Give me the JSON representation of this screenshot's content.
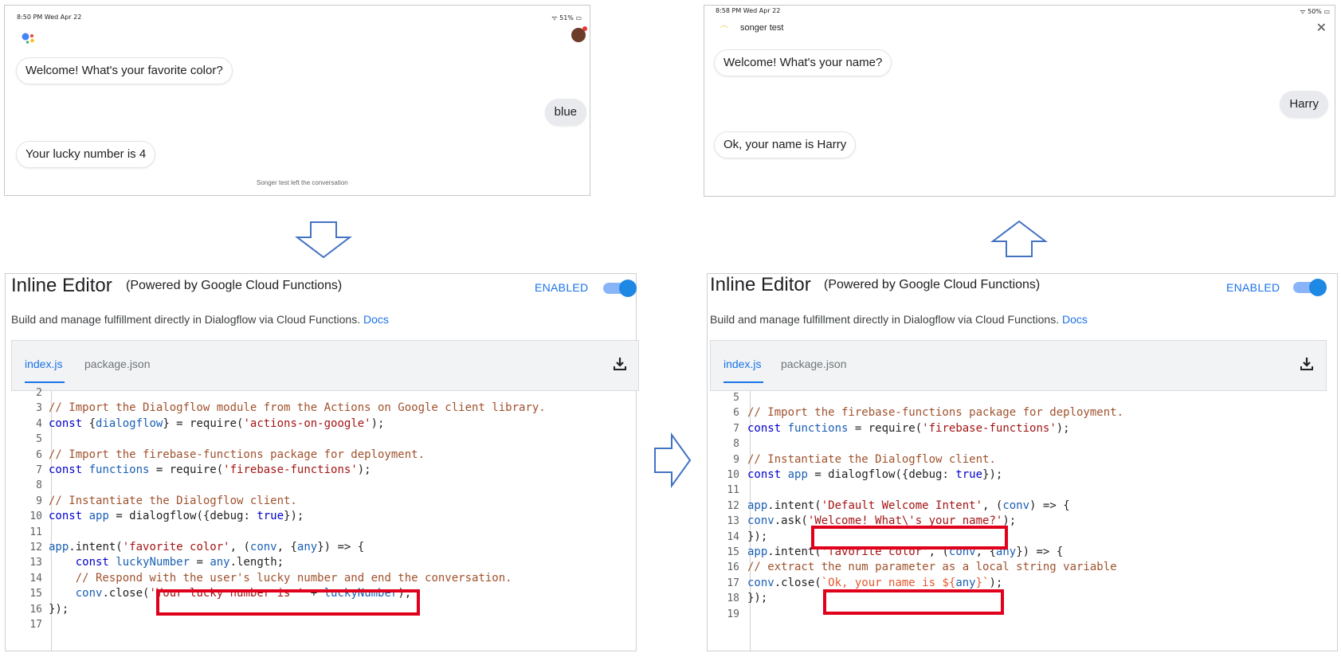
{
  "left_phone": {
    "status_time": "8:50 PM   Wed Apr 22",
    "status_right": "51%",
    "messages": [
      {
        "from": "bot",
        "text": "Welcome! What's your favorite color?"
      },
      {
        "from": "user",
        "text": "blue"
      },
      {
        "from": "bot",
        "text": "Your lucky number is 4"
      }
    ],
    "footer_note": "Songer test left the conversation"
  },
  "right_phone": {
    "status_time": "8:58 PM   Wed Apr 22",
    "status_right": "50%",
    "app_name": "songer test",
    "messages": [
      {
        "from": "bot",
        "text": "Welcome! What's your name?"
      },
      {
        "from": "user",
        "text": "Harry"
      },
      {
        "from": "bot",
        "text": "Ok, your name is Harry"
      }
    ]
  },
  "editor_common": {
    "title": "Inline Editor",
    "subtitle": "(Powered by Google Cloud Functions)",
    "enabled_label": "ENABLED",
    "description": "Build and manage fulfillment directly in Dialogflow via Cloud Functions.",
    "docs_link": "Docs",
    "tabs": [
      "index.js",
      "package.json"
    ]
  },
  "left_code": [
    {
      "n": "2",
      "t": ""
    },
    {
      "n": "3",
      "t": "// Import the Dialogflow module from the Actions on Google client library."
    },
    {
      "n": "4",
      "t": "const {dialogflow} = require('actions-on-google');"
    },
    {
      "n": "5",
      "t": ""
    },
    {
      "n": "6",
      "t": "// Import the firebase-functions package for deployment."
    },
    {
      "n": "7",
      "t": "const functions = require('firebase-functions');"
    },
    {
      "n": "8",
      "t": ""
    },
    {
      "n": "9",
      "t": "// Instantiate the Dialogflow client."
    },
    {
      "n": "10",
      "t": "const app = dialogflow({debug: true});"
    },
    {
      "n": "11",
      "t": ""
    },
    {
      "n": "12",
      "t": "app.intent('favorite color', (conv, {any}) => {"
    },
    {
      "n": "13",
      "t": "    const luckyNumber = any.length;"
    },
    {
      "n": "14",
      "t": "    // Respond with the user's lucky number and end the conversation."
    },
    {
      "n": "15",
      "t": "    conv.close('Your lucky number is ' + luckyNumber);"
    },
    {
      "n": "16",
      "t": "});"
    },
    {
      "n": "17",
      "t": ""
    }
  ],
  "right_code": [
    {
      "n": "5",
      "t": ""
    },
    {
      "n": "6",
      "t": "// Import the firebase-functions package for deployment."
    },
    {
      "n": "7",
      "t": "const functions = require('firebase-functions');"
    },
    {
      "n": "8",
      "t": ""
    },
    {
      "n": "9",
      "t": "// Instantiate the Dialogflow client."
    },
    {
      "n": "10",
      "t": "const app = dialogflow({debug: true});"
    },
    {
      "n": "11",
      "t": ""
    },
    {
      "n": "12",
      "t": "app.intent('Default Welcome Intent', (conv) => {"
    },
    {
      "n": "13",
      "t": "conv.ask('Welcome! What\\'s your name?');"
    },
    {
      "n": "14",
      "t": "});"
    },
    {
      "n": "15",
      "t": "app.intent('favorite color', (conv, {any}) => {"
    },
    {
      "n": "16",
      "t": "// extract the num parameter as a local string variable"
    },
    {
      "n": "17",
      "t": "conv.close(`Ok, your name is ${any}`);"
    },
    {
      "n": "18",
      "t": "});"
    },
    {
      "n": "19",
      "t": ""
    }
  ],
  "colors": {
    "accent": "#1a73e8",
    "highlight_box": "#e0001b",
    "arrow": "#4472c4"
  },
  "icons": [
    "assistant-logo-icon",
    "avatar-icon",
    "close-icon",
    "download-icon",
    "arrow-down-icon",
    "arrow-right-icon",
    "arrow-up-icon"
  ]
}
